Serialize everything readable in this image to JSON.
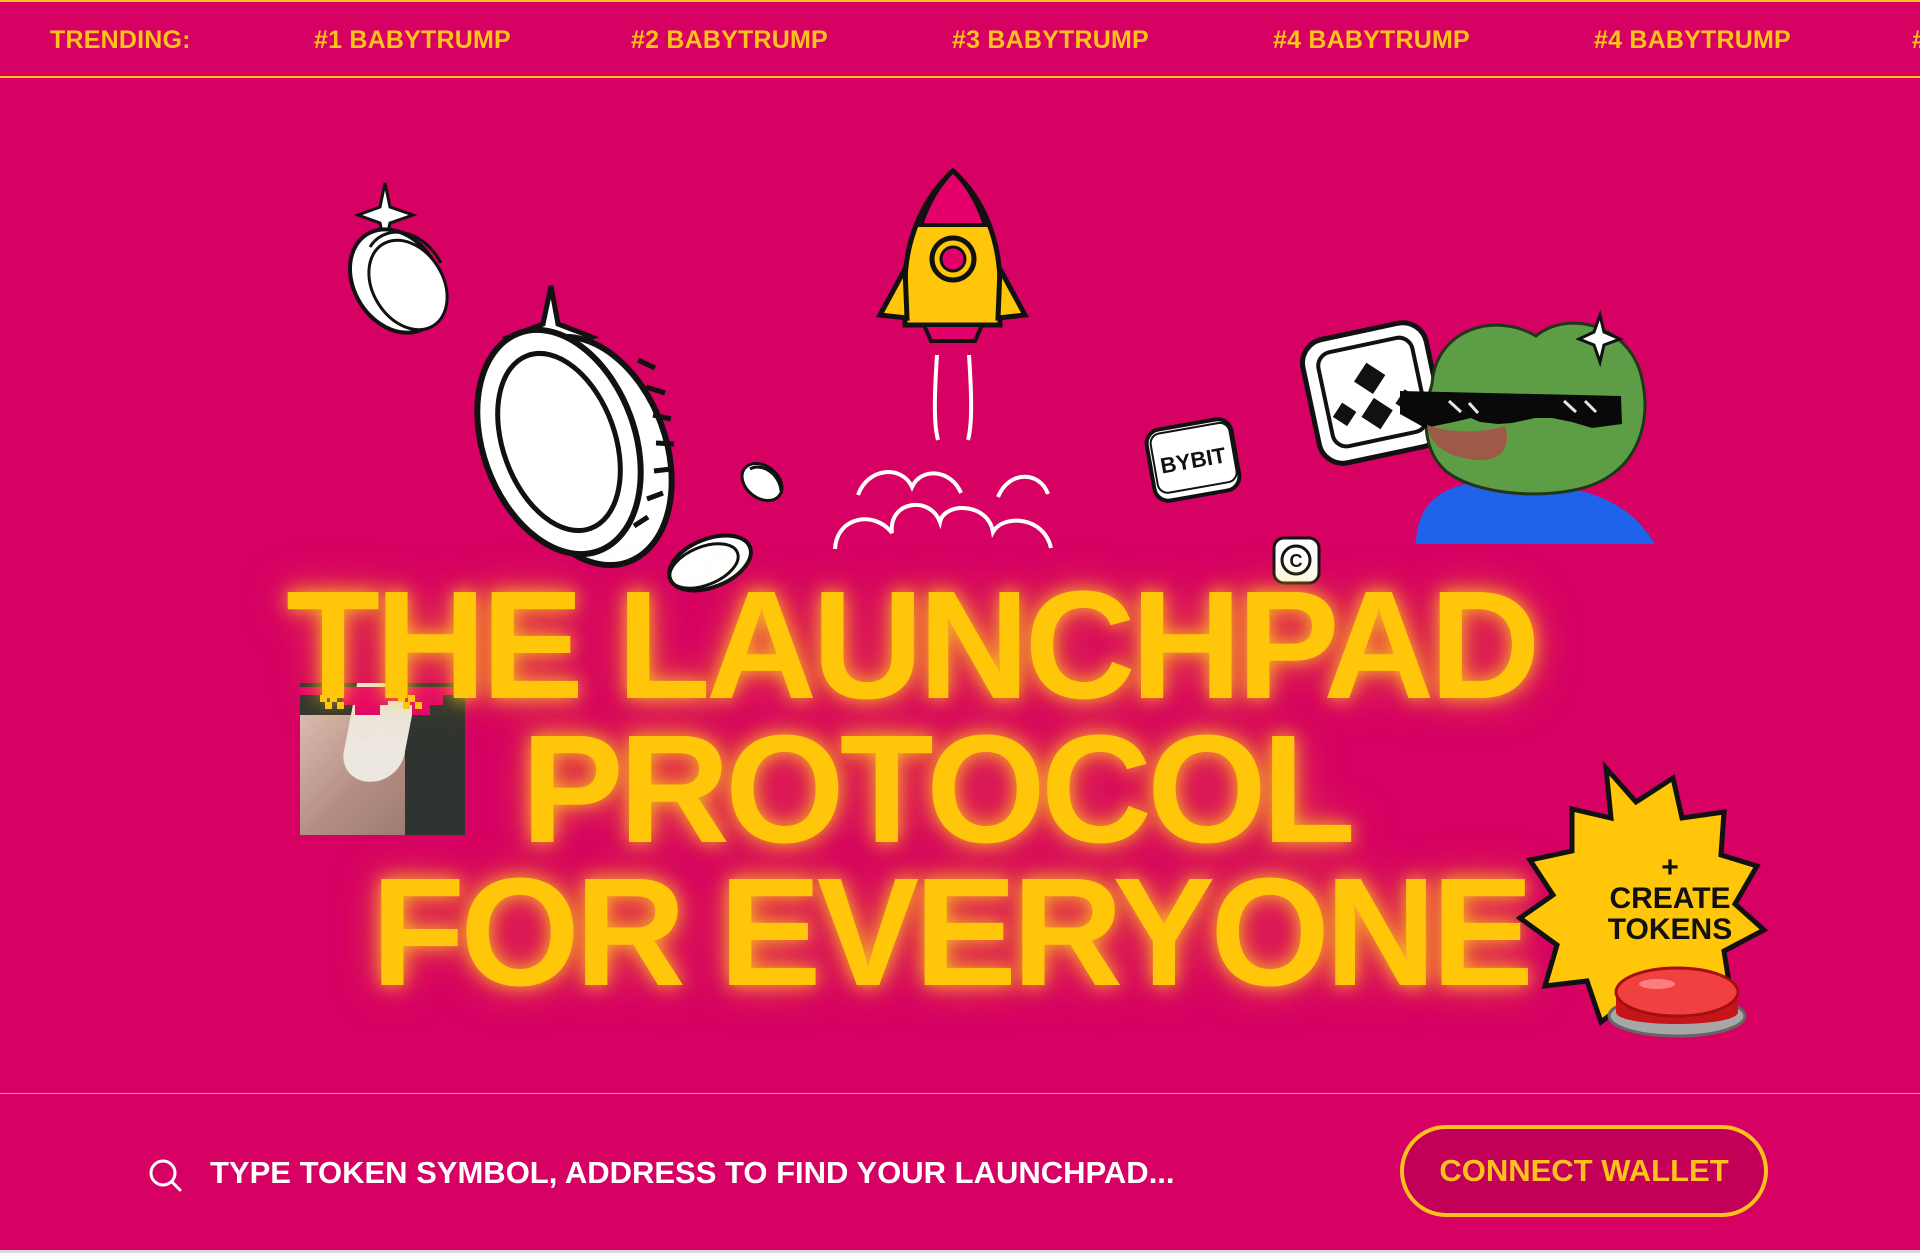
{
  "ticker": {
    "label": "TRENDING:",
    "items": [
      "#1 BABYTRUMP",
      "#2 BABYTRUMP",
      "#3 BABYTRUMP",
      "#4 BABYTRUMP",
      "#4 BABYTRUMP"
    ],
    "overflow_text": "#"
  },
  "hero": {
    "line1": "THE LAUNCHPAD",
    "line2": "PROTOCOL",
    "line3": "FOR EVERYONE"
  },
  "stickers": {
    "bybit_text": "BYBIT",
    "coin_c": "C"
  },
  "create_button": {
    "plus": "+",
    "label": "CREATE TOKENS"
  },
  "search": {
    "placeholder": "TYPE TOKEN SYMBOL, ADDRESS TO FIND YOUR LAUNCHPAD..."
  },
  "wallet": {
    "label": "CONNECT WALLET"
  },
  "colors": {
    "background": "#d60163",
    "accent": "#ffc60a",
    "text_white": "#ffffff"
  },
  "icons": [
    "search-icon",
    "rocket-icon",
    "coin-icon",
    "binance-icon",
    "bybit-icon",
    "pepe-sticker",
    "red-push-button",
    "nft-glasses"
  ]
}
